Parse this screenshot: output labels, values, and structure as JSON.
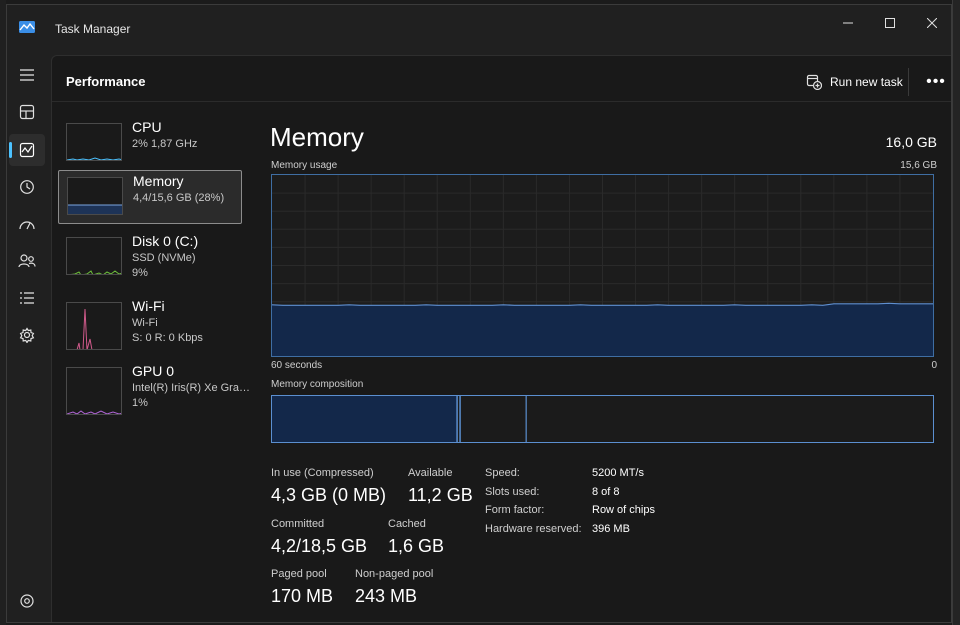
{
  "window": {
    "title": "Task Manager",
    "minimize_icon": "minimize-icon",
    "maximize_icon": "maximize-icon",
    "close_icon": "close-icon"
  },
  "nav": {
    "items": [
      "hamburger-menu-icon",
      "processes-icon",
      "performance-icon",
      "app-history-icon",
      "startup-apps-icon",
      "users-icon",
      "details-icon",
      "services-icon"
    ],
    "active": "performance-icon",
    "settings_icon": "settings-icon"
  },
  "header": {
    "page_title": "Performance",
    "run_new_task": "Run new task",
    "more_icon": "more-options-icon"
  },
  "resources": [
    {
      "name": "CPU",
      "line1": "2%  1,87 GHz",
      "line2": "",
      "color": "#4cc2ff"
    },
    {
      "name": "Memory",
      "line1": "4,4/15,6 GB (28%)",
      "line2": "",
      "color": "#7aa6e0"
    },
    {
      "name": "Disk 0 (C:)",
      "line1": "SSD (NVMe)",
      "line2": "9%",
      "color": "#6dbf3b"
    },
    {
      "name": "Wi-Fi",
      "line1": "Wi-Fi",
      "line2": "S: 0  R: 0 Kbps",
      "color": "#d05a8b"
    },
    {
      "name": "GPU 0",
      "line1": "Intel(R) Iris(R) Xe Graphics",
      "line2": "1%",
      "color": "#b266d9"
    }
  ],
  "selected_resource": "Memory",
  "detail": {
    "title": "Memory",
    "total": "16,0 GB",
    "usage_label": "Memory usage",
    "usage_max": "15,6 GB",
    "time_left": "60 seconds",
    "time_right": "0",
    "composition_label": "Memory composition",
    "usage_fraction": 0.28,
    "composition": {
      "in_use_fraction": 0.28,
      "modified_fraction": 0.003,
      "standby_fraction": 0.1
    },
    "stats": {
      "in_use_label": "In use (Compressed)",
      "in_use_value": "4,3 GB (0 MB)",
      "available_label": "Available",
      "available_value": "11,2 GB",
      "committed_label": "Committed",
      "committed_value": "4,2/18,5 GB",
      "cached_label": "Cached",
      "cached_value": "1,6 GB",
      "paged_label": "Paged pool",
      "paged_value": "170 MB",
      "nonpaged_label": "Non-paged pool",
      "nonpaged_value": "243 MB"
    },
    "specs": [
      {
        "label": "Speed:",
        "value": "5200 MT/s"
      },
      {
        "label": "Slots used:",
        "value": "8 of 8"
      },
      {
        "label": "Form factor:",
        "value": "Row of chips"
      },
      {
        "label": "Hardware reserved:",
        "value": "396 MB"
      }
    ]
  }
}
